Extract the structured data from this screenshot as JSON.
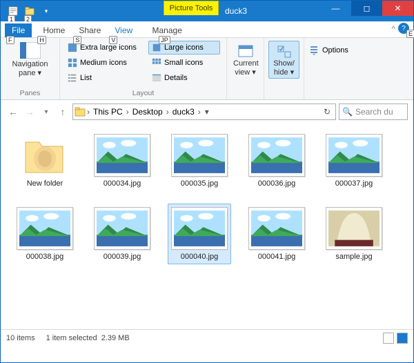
{
  "titlebar": {
    "tool_tab": "Picture Tools",
    "title": "duck3",
    "qat_tips": [
      "1",
      "2"
    ]
  },
  "tabs": {
    "file": "File",
    "file_tip": "F",
    "home": "Home",
    "home_tip": "H",
    "share": "Share",
    "share_tip": "S",
    "view": "View",
    "view_tip": "V",
    "manage": "Manage",
    "manage_tip": "JP",
    "help_tip": "E"
  },
  "ribbon": {
    "panes_group": "Panes",
    "navpane": "Navigation pane",
    "layout_group": "Layout",
    "extra_large": "Extra large icons",
    "large": "Large icons",
    "medium": "Medium icons",
    "small": "Small icons",
    "list": "List",
    "details": "Details",
    "current_view": "Current view",
    "show_hide": "Show/ hide",
    "options": "Options"
  },
  "address": {
    "this_pc": "This PC",
    "desktop": "Desktop",
    "duck3": "duck3",
    "search_placeholder": "Search du"
  },
  "files": [
    {
      "name": "New folder",
      "kind": "folder"
    },
    {
      "name": "000034.jpg",
      "kind": "img"
    },
    {
      "name": "000035.jpg",
      "kind": "img"
    },
    {
      "name": "000036.jpg",
      "kind": "img"
    },
    {
      "name": "000037.jpg",
      "kind": "img"
    },
    {
      "name": "000038.jpg",
      "kind": "img"
    },
    {
      "name": "000039.jpg",
      "kind": "img"
    },
    {
      "name": "000040.jpg",
      "kind": "img",
      "selected": true
    },
    {
      "name": "000041.jpg",
      "kind": "img"
    },
    {
      "name": "sample.jpg",
      "kind": "sample"
    }
  ],
  "status": {
    "count": "10 items",
    "selection": "1 item selected",
    "size": "2.39 MB"
  }
}
